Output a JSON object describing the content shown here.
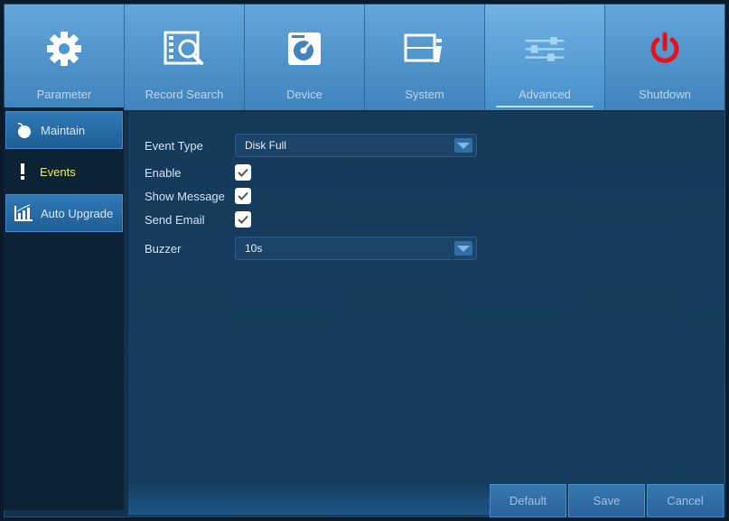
{
  "topbar": {
    "tabs": [
      {
        "label": "Parameter",
        "icon": "gear-icon"
      },
      {
        "label": "Record Search",
        "icon": "film-search-icon"
      },
      {
        "label": "Device",
        "icon": "disk-icon"
      },
      {
        "label": "System",
        "icon": "system-info-icon"
      },
      {
        "label": "Advanced",
        "icon": "sliders-icon",
        "active": true
      },
      {
        "label": "Shutdown",
        "icon": "power-icon"
      }
    ]
  },
  "sidebar": {
    "items": [
      {
        "label": "Maintain",
        "icon": "mouse-icon"
      },
      {
        "label": "Events",
        "icon": "exclamation-icon",
        "selected": true
      },
      {
        "label": "Auto Upgrade",
        "icon": "bar-chart-icon"
      }
    ]
  },
  "form": {
    "event_type": {
      "label": "Event Type",
      "value": "Disk Full"
    },
    "enable": {
      "label": "Enable",
      "checked": true
    },
    "show_message": {
      "label": "Show Message",
      "checked": true
    },
    "send_email": {
      "label": "Send Email",
      "checked": true
    },
    "buzzer": {
      "label": "Buzzer",
      "value": "10s"
    }
  },
  "buttons": {
    "default": "Default",
    "save": "Save",
    "cancel": "Cancel"
  },
  "colors": {
    "accent_blue": "#4a90c8",
    "selected_text": "#e6f24a",
    "power_red": "#e8111a"
  }
}
